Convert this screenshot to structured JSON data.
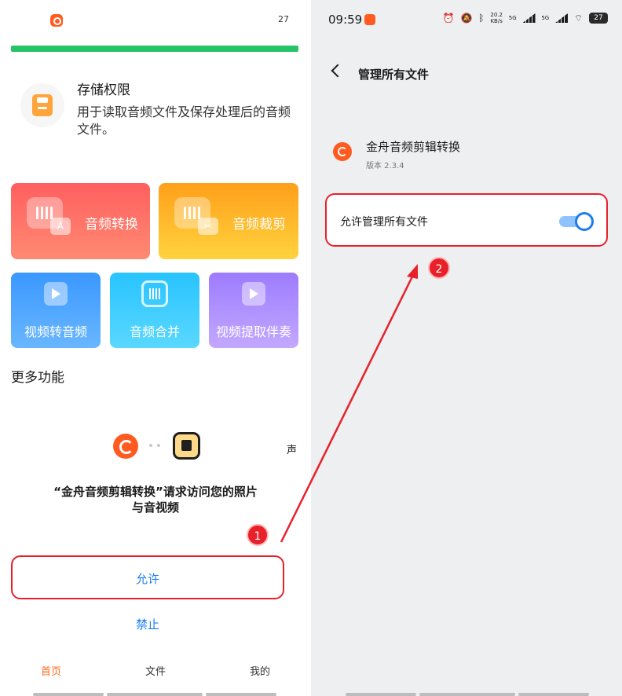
{
  "left": {
    "status_number": "27",
    "permission": {
      "title": "存储权限",
      "description": "用于读取音频文件及保存处理后的音频文件。"
    },
    "features_large": [
      {
        "label": "音频转换",
        "badge": "A"
      },
      {
        "label": "音频裁剪",
        "badge": "✂"
      }
    ],
    "features_small": [
      {
        "label": "视频转音频"
      },
      {
        "label": "音频合并"
      },
      {
        "label": "视频提取伴奏"
      }
    ],
    "more_title": "更多功能",
    "side_text": "声",
    "dialog": {
      "message_line1": "“金舟音频剪辑转换”请求访问您的照片",
      "message_line2": "与音视频",
      "allow_label": "允许",
      "deny_label": "禁止"
    },
    "bottom_nav": [
      {
        "label": "首页",
        "active": true
      },
      {
        "label": "文件",
        "active": false
      },
      {
        "label": "我的",
        "active": false
      }
    ]
  },
  "right": {
    "time": "09:59",
    "net_speed_value": "20.2",
    "net_speed_unit": "KB/s",
    "signal_label_1": "5G",
    "signal_label_2": "5G",
    "battery": "27",
    "page_title": "管理所有文件",
    "app_name": "金舟音频剪辑转换",
    "app_version": "版本 2.3.4",
    "toggle_label": "允许管理所有文件",
    "toggle_on": true
  },
  "annotations": {
    "step1": "1",
    "step2": "2",
    "highlight_color": "#e8202a",
    "arrow_color": "#e8202a"
  },
  "colors": {
    "accent_blue": "#1d7df0",
    "brand_orange": "#ff5a1f",
    "progress_green": "#27c367"
  }
}
